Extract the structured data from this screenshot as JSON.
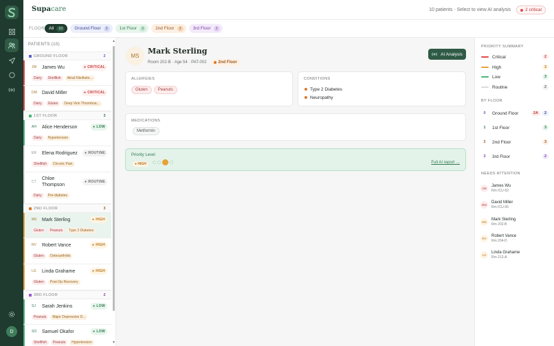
{
  "app": {
    "brand_main": "Supa",
    "brand_accent": "care"
  },
  "header": {
    "info": "10 patients · Select to view AI analysis",
    "critical_badge": "2 critical"
  },
  "filter": {
    "label": "FLOOR",
    "chips": [
      {
        "label": "All",
        "count": "10",
        "active": true
      },
      {
        "label": "Ground Floor",
        "count": "2"
      },
      {
        "label": "1st Floor",
        "count": "3"
      },
      {
        "label": "2nd Floor",
        "count": "3"
      },
      {
        "label": "3rd Floor",
        "count": "2"
      }
    ]
  },
  "patients_list": {
    "title": "PATIENTS (10)",
    "groups": [
      {
        "name": "GROUND FLOOR",
        "count": "2"
      },
      {
        "name": "1ST FLOOR",
        "count": "3"
      },
      {
        "name": "2ND FLOOR",
        "count": "3"
      },
      {
        "name": "3RD FLOOR",
        "count": "2"
      }
    ],
    "patients": [
      {
        "initials": "JW",
        "name": "James Wu",
        "priority": "CRITICAL",
        "allergies": [
          "Dairy",
          "Shellfish"
        ],
        "conditions": [
          "Atrial Fibrillatio..."
        ]
      },
      {
        "initials": "DM",
        "name": "David Miller",
        "priority": "CRITICAL",
        "allergies": [
          "Dairy",
          "Gluten"
        ],
        "conditions": [
          "Deep Vein Thromboa..."
        ]
      },
      {
        "initials": "AH",
        "name": "Alice Henderson",
        "priority": "LOW",
        "allergies": [
          "Dairy"
        ],
        "conditions": [
          "Hypertension"
        ]
      },
      {
        "initials": "ER",
        "name": "Elena Rodriguez",
        "priority": "ROUTINE",
        "allergies": [
          "Shellfish"
        ],
        "conditions": [
          "Chronic Pain"
        ]
      },
      {
        "initials": "CT",
        "name_line1": "Chloe",
        "name_line2": "Thompson",
        "priority": "ROUTINE",
        "allergies": [
          "Dairy"
        ],
        "conditions": [
          "Pre-diabetes"
        ]
      },
      {
        "initials": "MS",
        "name": "Mark Sterling",
        "priority": "HIGH",
        "allergies": [
          "Gluten",
          "Peanuts"
        ],
        "conditions": [
          "Type 2 Diabetes"
        ]
      },
      {
        "initials": "RV",
        "name": "Robert Vance",
        "priority": "HIGH",
        "allergies": [
          "Gluten"
        ],
        "conditions": [
          "Osteoarthritis"
        ]
      },
      {
        "initials": "LG",
        "name": "Linda Grahame",
        "priority": "HIGH",
        "allergies": [
          "Gluten"
        ],
        "conditions": [
          "Post-Op Recovery"
        ]
      },
      {
        "initials": "SJ",
        "name": "Sarah Jenkins",
        "priority": "LOW",
        "allergies": [
          "Peanuts"
        ],
        "conditions": [
          "Major Depressive D..."
        ]
      },
      {
        "initials": "SO",
        "name": "Samuel Okafor",
        "priority": "LOW",
        "allergies": [
          "Shellfish",
          "Peanuts"
        ],
        "conditions": [
          "Hypertension"
        ]
      }
    ]
  },
  "detail": {
    "initials": "MS",
    "name": "Mark Sterling",
    "room": "Room 202-B",
    "age": "Age 54",
    "id": "PAT-002",
    "floor": "2nd Floor",
    "ai_button": "AI Analysis",
    "allergies_title": "ALLERGIES",
    "allergies": [
      "Gluten",
      "Peanuts"
    ],
    "conditions_title": "CONDITIONS",
    "conditions": [
      "Type 2 Diabetes",
      "Neuropathy"
    ],
    "medications_title": "MEDICATIONS",
    "medications": [
      "Metformin"
    ],
    "priority_title": "Priority Level",
    "priority": "HIGH",
    "priority_level": 3,
    "priority_steps": 4,
    "report_link": "Full AI report →"
  },
  "summary": {
    "priority_title": "PRIORITY SUMMARY",
    "priorities": [
      {
        "label": "Critical",
        "count": "2",
        "color": "#e04a4a"
      },
      {
        "label": "High",
        "count": "3",
        "color": "#e7a23a"
      },
      {
        "label": "Low",
        "count": "3",
        "color": "#49b47a"
      },
      {
        "label": "Routine",
        "count": "2",
        "color": "#cdd0ce"
      }
    ],
    "floor_title": "BY FLOOR",
    "floors": [
      {
        "num": "0",
        "label": "Ground Floor",
        "alert": "2A",
        "count": "2"
      },
      {
        "num": "1",
        "label": "1st Floor",
        "count": "3"
      },
      {
        "num": "2",
        "label": "2nd Floor",
        "count": "3"
      },
      {
        "num": "3",
        "label": "3rd Floor",
        "count": "2"
      }
    ],
    "attention_title": "NEEDS ATTENTION",
    "attention": [
      {
        "initials": "JW",
        "name": "James Wu",
        "room": "Rm ICU-02"
      },
      {
        "initials": "DM",
        "name": "David Miller",
        "room": "Rm ICU-05"
      },
      {
        "initials": "MS",
        "name": "Mark Sterling",
        "room": "Rm 202-B"
      },
      {
        "initials": "RV",
        "name": "Robert Vance",
        "room": "Rm 204-D"
      },
      {
        "initials": "LG",
        "name": "Linda Grahame",
        "room": "Rm 212-A"
      }
    ]
  },
  "user": {
    "initial": "D"
  }
}
